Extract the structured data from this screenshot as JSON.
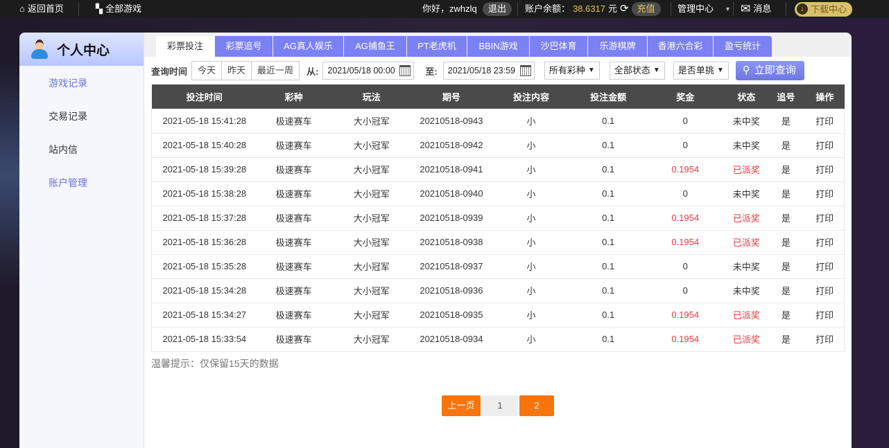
{
  "topbar": {
    "home": "返回首页",
    "all_games": "全部游戏",
    "greeting": "你好，zwhzlq",
    "logout": "退出",
    "balance_label": "账户余额：",
    "balance": "38.6317",
    "currency": "元",
    "recharge": "充值",
    "admin": "管理中心",
    "messages": "消息",
    "download": "下载中心"
  },
  "sidebar": {
    "title": "个人中心",
    "items": [
      "游戏记录",
      "交易记录",
      "站内信",
      "账户管理"
    ]
  },
  "tabs": [
    "彩票投注",
    "彩票追号",
    "AG真人娱乐",
    "AG捕鱼王",
    "PT老虎机",
    "BBIN游戏",
    "沙巴体育",
    "乐游棋牌",
    "香港六合彩",
    "盈亏统计"
  ],
  "filter": {
    "label": "查询时间",
    "quick": [
      "今天",
      "昨天",
      "最近一周"
    ],
    "from_label": "从:",
    "from": "2021/05/18 00:00",
    "to_label": "至:",
    "to": "2021/05/18 23:59",
    "lottery": "所有彩种",
    "status": "全部状态",
    "single": "是否单挑",
    "query": "立即查询"
  },
  "table": {
    "headers": [
      "投注时间",
      "彩种",
      "玩法",
      "期号",
      "投注内容",
      "投注金额",
      "奖金",
      "状态",
      "追号",
      "操作"
    ],
    "rows": [
      [
        "2021-05-18 15:41:28",
        "极速赛车",
        "大小冠军",
        "20210518-0943",
        "小",
        "0.1",
        "0",
        "未中奖",
        "是",
        "打印"
      ],
      [
        "2021-05-18 15:40:28",
        "极速赛车",
        "大小冠军",
        "20210518-0942",
        "小",
        "0.1",
        "0",
        "未中奖",
        "是",
        "打印"
      ],
      [
        "2021-05-18 15:39:28",
        "极速赛车",
        "大小冠军",
        "20210518-0941",
        "小",
        "0.1",
        "0.1954",
        "已派奖",
        "是",
        "打印"
      ],
      [
        "2021-05-18 15:38:28",
        "极速赛车",
        "大小冠军",
        "20210518-0940",
        "小",
        "0.1",
        "0",
        "未中奖",
        "是",
        "打印"
      ],
      [
        "2021-05-18 15:37:28",
        "极速赛车",
        "大小冠军",
        "20210518-0939",
        "小",
        "0.1",
        "0.1954",
        "已派奖",
        "是",
        "打印"
      ],
      [
        "2021-05-18 15:36:28",
        "极速赛车",
        "大小冠军",
        "20210518-0938",
        "小",
        "0.1",
        "0.1954",
        "已派奖",
        "是",
        "打印"
      ],
      [
        "2021-05-18 15:35:28",
        "极速赛车",
        "大小冠军",
        "20210518-0937",
        "小",
        "0.1",
        "0",
        "未中奖",
        "是",
        "打印"
      ],
      [
        "2021-05-18 15:34:28",
        "极速赛车",
        "大小冠军",
        "20210518-0936",
        "小",
        "0.1",
        "0",
        "未中奖",
        "是",
        "打印"
      ],
      [
        "2021-05-18 15:34:27",
        "极速赛车",
        "大小冠军",
        "20210518-0935",
        "小",
        "0.1",
        "0.1954",
        "已派奖",
        "是",
        "打印"
      ],
      [
        "2021-05-18 15:33:54",
        "极速赛车",
        "大小冠军",
        "20210518-0934",
        "小",
        "0.1",
        "0.1954",
        "已派奖",
        "是",
        "打印"
      ]
    ]
  },
  "tip": "温馨提示：仅保留15天的数据",
  "pager": {
    "prev": "上一页",
    "pages": [
      "1",
      "2"
    ],
    "current": "2"
  },
  "colors": {
    "accent": "#7b80f2",
    "orange": "#f8740c",
    "win": "#e8383d"
  }
}
